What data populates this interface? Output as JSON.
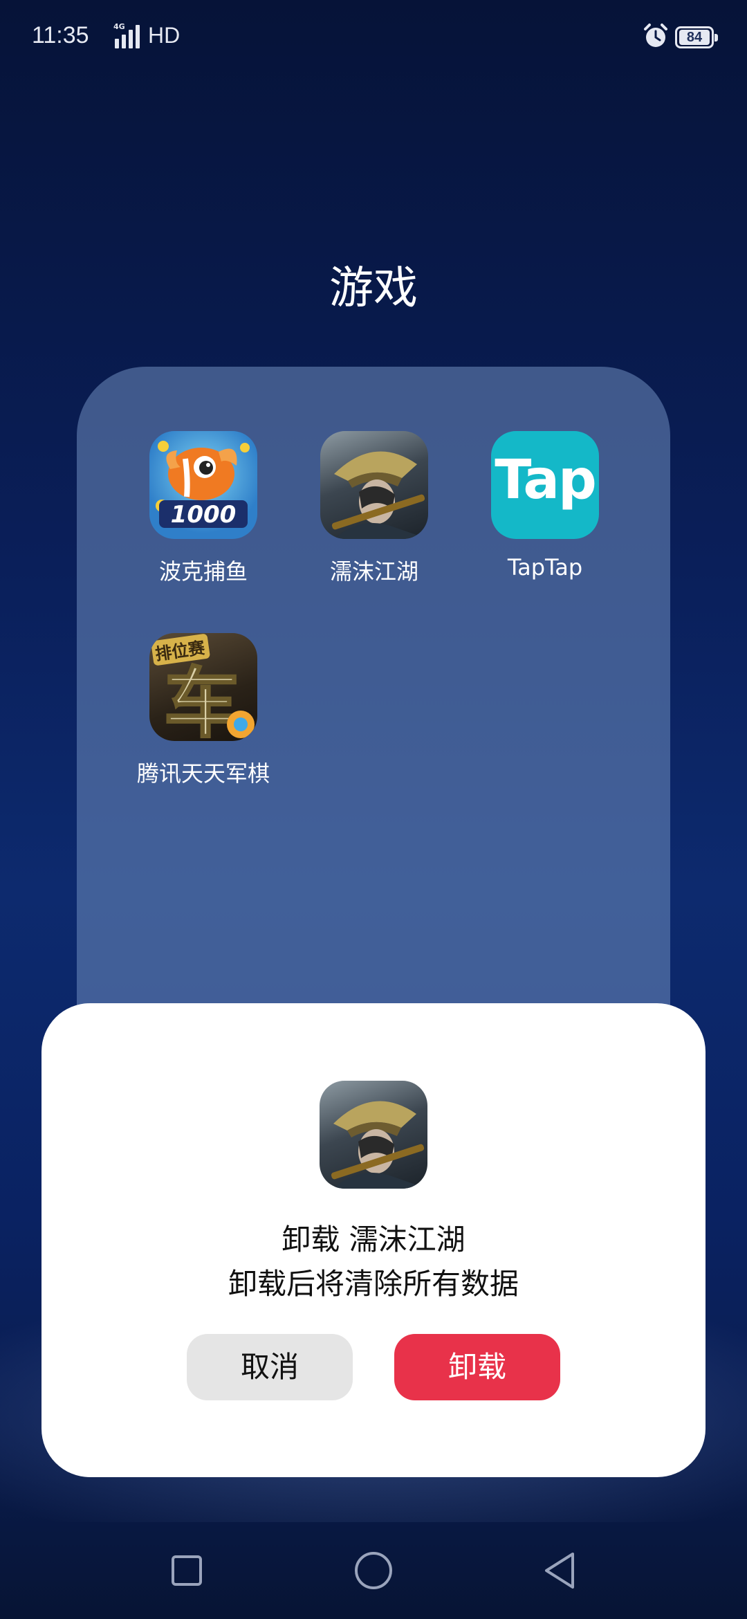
{
  "status_bar": {
    "time": "11:35",
    "network": "4G",
    "hd": "HD",
    "battery": "84"
  },
  "folder": {
    "title": "游戏",
    "apps": [
      {
        "label": "波克捕鱼",
        "icon": "fish-game-icon"
      },
      {
        "label": "濡沫江湖",
        "icon": "swordsman-game-icon"
      },
      {
        "label": "TapTap",
        "icon": "taptap-icon",
        "icon_text": "Tap"
      },
      {
        "label": "腾讯天天军棋",
        "icon": "army-chess-icon",
        "icon_text": "车"
      }
    ],
    "fish_badge": "1000",
    "chess_banner": "排位赛"
  },
  "dialog": {
    "title": "卸载 濡沫江湖",
    "message": "卸载后将清除所有数据",
    "cancel_label": "取消",
    "confirm_label": "卸载",
    "confirm_color": "#e8324a"
  },
  "nav": {
    "recent": "square-icon",
    "home": "circle-icon",
    "back": "triangle-back-icon"
  }
}
